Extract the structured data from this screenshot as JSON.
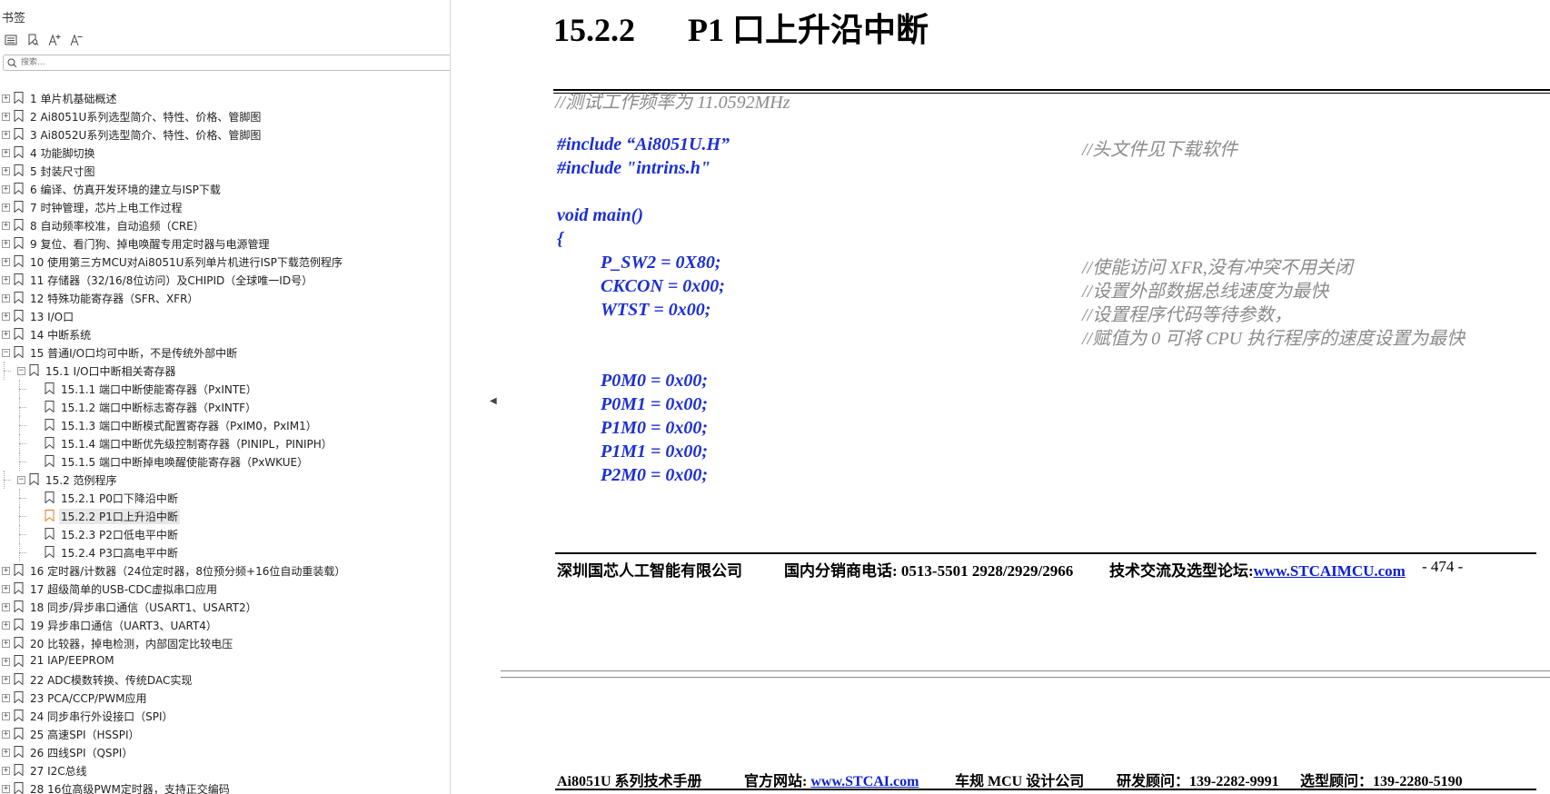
{
  "sidebar": {
    "title": "书签",
    "toolbar": [
      "outline-icon",
      "bookmark-search-icon",
      "font-increase-icon",
      "font-decrease-icon"
    ],
    "search_placeholder": "搜索...",
    "items": [
      {
        "label": "1 单片机基础概述",
        "level": 0,
        "expand": "plus"
      },
      {
        "label": "2  Ai8051U系列选型简介、特性、价格、管脚图",
        "level": 0,
        "expand": "plus"
      },
      {
        "label": "3  Ai8052U系列选型简介、特性、价格、管脚图",
        "level": 0,
        "expand": "plus"
      },
      {
        "label": "4  功能脚切换",
        "level": 0,
        "expand": "plus"
      },
      {
        "label": "5  封装尺寸图",
        "level": 0,
        "expand": "plus"
      },
      {
        "label": "6  编译、仿真开发环境的建立与ISP下载",
        "level": 0,
        "expand": "plus"
      },
      {
        "label": "7  时钟管理，芯片上电工作过程",
        "level": 0,
        "expand": "plus"
      },
      {
        "label": "8  自动频率校准，自动追频（CRE）",
        "level": 0,
        "expand": "plus"
      },
      {
        "label": "9  复位、看门狗、掉电唤醒专用定时器与电源管理",
        "level": 0,
        "expand": "plus"
      },
      {
        "label": "10  使用第三方MCU对Ai8051U系列单片机进行ISP下载范例程序",
        "level": 0,
        "expand": "plus"
      },
      {
        "label": "11  存储器（32/16/8位访问）及CHIPID（全球唯一ID号）",
        "level": 0,
        "expand": "plus"
      },
      {
        "label": "12  特殊功能寄存器（SFR、XFR）",
        "level": 0,
        "expand": "plus"
      },
      {
        "label": "13  I/O口",
        "level": 0,
        "expand": "plus"
      },
      {
        "label": "14  中断系统",
        "level": 0,
        "expand": "plus"
      },
      {
        "label": "15  普通I/O口均可中断，不是传统外部中断",
        "level": 0,
        "expand": "minus"
      },
      {
        "label": "15.1 I/O口中断相关寄存器",
        "level": 1,
        "expand": "minus"
      },
      {
        "label": "15.1.1 端口中断使能寄存器（PxINTE）",
        "level": 2,
        "expand": ""
      },
      {
        "label": "15.1.2  端口中断标志寄存器（PxINTF）",
        "level": 2,
        "expand": ""
      },
      {
        "label": "15.1.3 端口中断模式配置寄存器（PxIM0，PxIM1）",
        "level": 2,
        "expand": ""
      },
      {
        "label": "15.1.4  端口中断优先级控制寄存器（PINIPL，PINIPH）",
        "level": 2,
        "expand": ""
      },
      {
        "label": "15.1.5 端口中断掉电唤醒使能寄存器（PxWKUE）",
        "level": 2,
        "expand": ""
      },
      {
        "label": "15.2  范例程序",
        "level": 1,
        "expand": "minus"
      },
      {
        "label": "15.2.1 P0口下降沿中断",
        "level": 2,
        "expand": ""
      },
      {
        "label": "15.2.2 P1口上升沿中断",
        "level": 2,
        "expand": "",
        "selected": true
      },
      {
        "label": "15.2.3 P2口低电平中断",
        "level": 2,
        "expand": ""
      },
      {
        "label": "15.2.4 P3口高电平中断",
        "level": 2,
        "expand": ""
      },
      {
        "label": "16  定时器/计数器（24位定时器，8位预分频+16位自动重装载）",
        "level": 0,
        "expand": "plus"
      },
      {
        "label": "17  超级简单的USB-CDC虚拟串口应用",
        "level": 0,
        "expand": "plus"
      },
      {
        "label": "18  同步/异步串口通信（USART1、USART2）",
        "level": 0,
        "expand": "plus"
      },
      {
        "label": "19  异步串口通信（UART3、UART4）",
        "level": 0,
        "expand": "plus"
      },
      {
        "label": "20  比较器，掉电检测，内部固定比较电压",
        "level": 0,
        "expand": "plus"
      },
      {
        "label": "21  IAP/EEPROM",
        "level": 0,
        "expand": "plus"
      },
      {
        "label": "22  ADC模数转换、传统DAC实现",
        "level": 0,
        "expand": "plus"
      },
      {
        "label": "23  PCA/CCP/PWM应用",
        "level": 0,
        "expand": "plus"
      },
      {
        "label": "24  同步串行外设接口（SPI）",
        "level": 0,
        "expand": "plus"
      },
      {
        "label": "25  高速SPI（HSSPI）",
        "level": 0,
        "expand": "plus"
      },
      {
        "label": "26  四线SPI（QSPI）",
        "level": 0,
        "expand": "plus"
      },
      {
        "label": "27  I2C总线",
        "level": 0,
        "expand": "plus"
      },
      {
        "label": "28  16位高级PWM定时器，支持正交编码",
        "level": 0,
        "expand": "plus"
      }
    ]
  },
  "document": {
    "heading_number": "15.2.2",
    "heading_title": "P1 口上升沿中断",
    "freq_comment": "//测试工作频率为 11.0592MHz",
    "include1": "#include “Ai8051U.H”",
    "include1_comment": "//头文件见下载软件",
    "include2": "#include \"intrins.h\"",
    "main_decl": "void main()",
    "brace_open": "{",
    "stmt_psw2": "P_SW2 = 0X80;",
    "cmt_psw2": "//使能访问 XFR,没有冲突不用关闭",
    "stmt_ckcon": "CKCON = 0x00;",
    "cmt_ckcon": "//设置外部数据总线速度为最快",
    "stmt_wtst": "WTST = 0x00;",
    "cmt_wtst": "//设置程序代码等待参数，",
    "cmt_wtst2": "//赋值为 0 可将 CPU 执行程序的速度设置为最快",
    "stmt_p0m0": "P0M0 = 0x00;",
    "stmt_p0m1": "P0M1 = 0x00;",
    "stmt_p1m0": "P1M0 = 0x00;",
    "stmt_p1m1": "P1M1 = 0x00;",
    "stmt_p2m0": "P2M0 = 0x00;",
    "footer1": {
      "company": "深圳国芯人工智能有限公司",
      "phone": "国内分销商电话: 0513-5501 2928/2929/2966",
      "forum_label": "技术交流及选型论坛:",
      "forum_link": "www.STCAIMCU.com",
      "page": "- 474 -"
    },
    "footer2": {
      "manual": "Ai8051U 系列技术手册",
      "site_label": "官方网站: ",
      "site_link": "www.STCAI.com",
      "designer": "车规 MCU 设计公司",
      "rd": "研发顾问：139-2282-9991",
      "sel": "选型顾问：139-2280-5190"
    }
  }
}
